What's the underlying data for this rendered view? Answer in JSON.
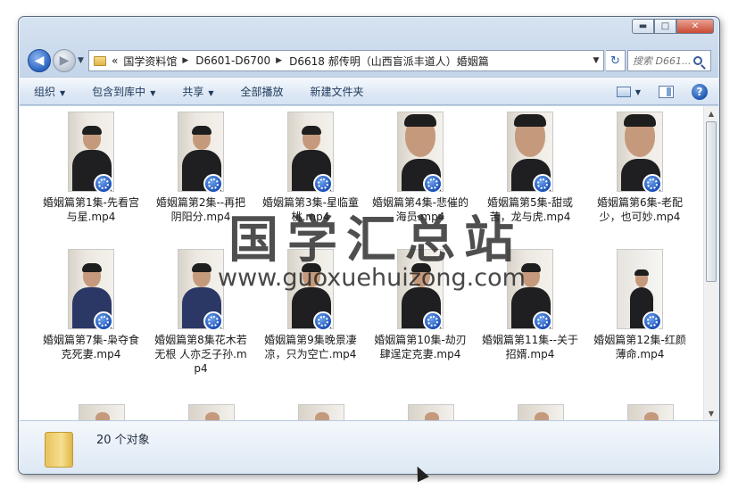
{
  "window": {
    "controls": {
      "minimize": "▬",
      "maximize": "□",
      "close": "✕"
    }
  },
  "nav": {
    "back_icon": "arrow-left-icon",
    "forward_icon": "arrow-right-icon",
    "history_glyph": "▼",
    "address_prefix": "«",
    "crumbs": [
      "国学资料馆",
      "D6601-D6700",
      "D6618 郝传明（山西盲派丰道人）婚姻篇"
    ],
    "crumb_sep": "▶",
    "address_drop": "▼",
    "refresh_glyph": "↻",
    "search_placeholder": "搜索 D661..."
  },
  "toolbar": {
    "items": [
      "组织",
      "包含到库中",
      "共享",
      "全部播放",
      "新建文件夹"
    ],
    "dropdown_glyph": "▼",
    "help_glyph": "?"
  },
  "files": [
    "婚姻篇第1集-先看宫与星.mp4",
    "婚姻篇第2集--再把阴阳分.mp4",
    "婚姻篇第3集-星临童桃.mp4",
    "婚姻篇第4集-悲催的海员.mp4",
    "婚姻篇第5集-甜或苦，龙与虎.mp4",
    "婚姻篇第6集-老配少，也可妙.mp4",
    "婚姻篇第7集-枭夺食克死妻.mp4",
    "婚姻篇第8集花木若无根 人亦乏子孙.mp4",
    "婚姻篇第9集晚景凄凉，只为空亡.mp4",
    "婚姻篇第10集-劫刃肆逞定克妻.mp4",
    "婚姻篇第11集--关于招婿.mp4",
    "婚姻篇第12集-红颜薄命.mp4"
  ],
  "scroll": {
    "up_glyph": "▲",
    "down_glyph": "▼"
  },
  "details": {
    "count": "20 个对象"
  },
  "watermark": {
    "cn": "国学汇总站",
    "en": "www.guoxuehuizong.com"
  }
}
